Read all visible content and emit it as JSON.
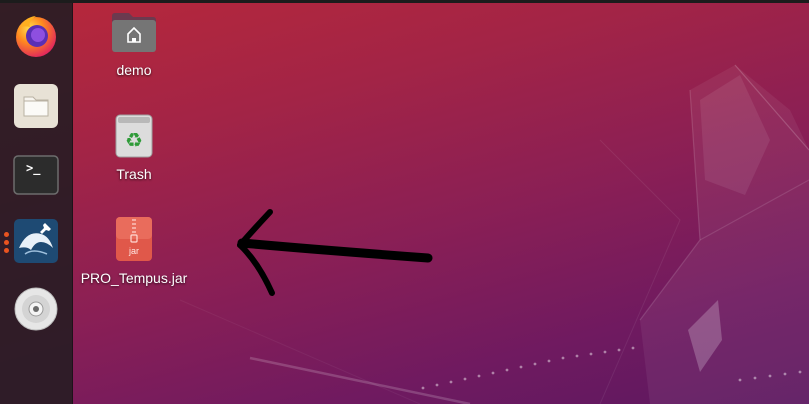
{
  "dock": {
    "items": [
      {
        "name": "firefox",
        "icon": "firefox-icon",
        "running": false
      },
      {
        "name": "files",
        "icon": "folder-icon",
        "running": false
      },
      {
        "name": "terminal",
        "icon": "terminal-icon",
        "running": false
      },
      {
        "name": "mysql-workbench",
        "icon": "dolphin-wrench-icon",
        "running": true
      },
      {
        "name": "optical-drive",
        "icon": "disc-icon",
        "running": false
      }
    ],
    "terminal_prompt": ">_"
  },
  "desktop": {
    "icons": [
      {
        "label": "demo",
        "icon": "home-folder-icon"
      },
      {
        "label": "Trash",
        "icon": "trash-icon"
      },
      {
        "label": "PRO_Tempus.jar",
        "icon": "jar-file-icon",
        "badge": "jar"
      }
    ]
  },
  "annotation": {
    "type": "arrow",
    "direction": "left",
    "color": "#000000"
  },
  "colors": {
    "accent": "#e95420",
    "background_top": "#b8283a",
    "background_bottom": "#5c1860"
  }
}
